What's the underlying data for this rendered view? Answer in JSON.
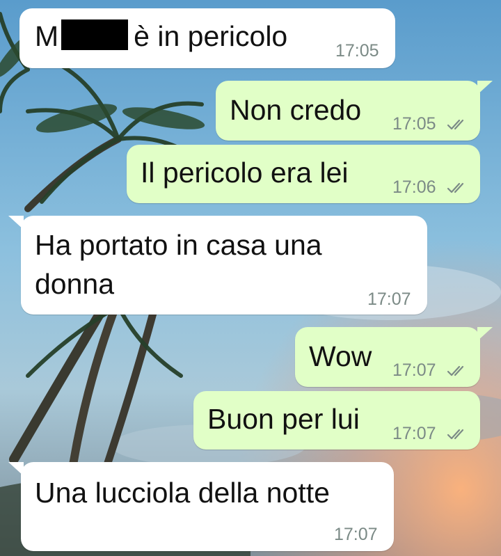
{
  "colors": {
    "incoming_bubble": "#ffffff",
    "outgoing_bubble": "#e1ffc7",
    "timestamp": "#7b8a86",
    "text": "#111111"
  },
  "messages": [
    {
      "direction": "incoming",
      "text_prefix": "M",
      "text_suffix": "è in pericolo",
      "redacted": true,
      "time": "17:05"
    },
    {
      "direction": "outgoing",
      "text": "Non credo",
      "time": "17:05",
      "status": "double-check-icon"
    },
    {
      "direction": "outgoing",
      "text": "Il pericolo era lei",
      "time": "17:06",
      "status": "double-check-icon"
    },
    {
      "direction": "incoming",
      "line1": "Ha portato in casa una",
      "line2": "donna",
      "time": "17:07"
    },
    {
      "direction": "outgoing",
      "text": "Wow",
      "time": "17:07",
      "status": "double-check-icon"
    },
    {
      "direction": "outgoing",
      "text": "Buon per lui",
      "time": "17:07",
      "status": "double-check-icon"
    },
    {
      "direction": "incoming",
      "text": "Una lucciola della notte",
      "time": "17:07"
    }
  ]
}
